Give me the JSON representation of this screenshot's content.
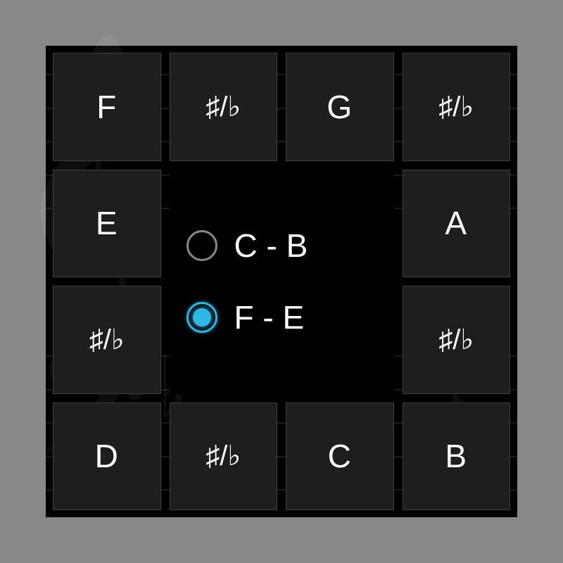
{
  "accidental_label": "♯/♭",
  "cells": {
    "r0c0": "F",
    "r0c1": "♯/♭",
    "r0c2": "G",
    "r0c3": "♯/♭",
    "r1c0": "E",
    "r1c3": "A",
    "r2c0": "♯/♭",
    "r2c3": "♯/♭",
    "r3c0": "D",
    "r3c1": "♯/♭",
    "r3c2": "C",
    "r3c3": "B"
  },
  "center": {
    "options": [
      {
        "id": "range-c-b",
        "label": "C - B",
        "selected": false
      },
      {
        "id": "range-f-e",
        "label": "F - E",
        "selected": true
      }
    ]
  },
  "decor": {
    "treble_clef": "𝄞",
    "bass_clef": "𝄢",
    "note": "♪",
    "flat": "♭"
  }
}
